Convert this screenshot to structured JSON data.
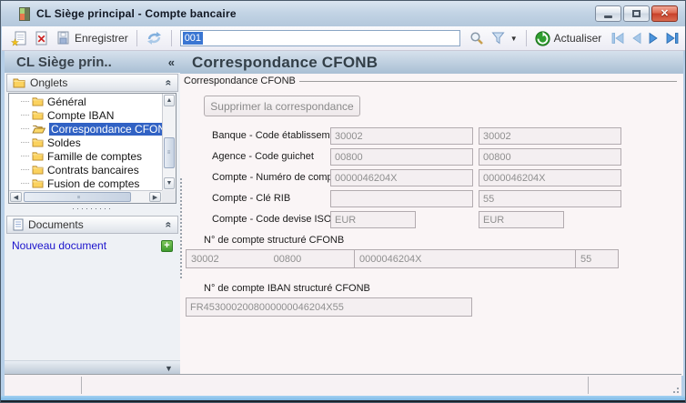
{
  "colors": {
    "selection_blue": "#3162c4",
    "link_blue": "#1a12cc",
    "close_red": "#c8402a",
    "plus_green": "#3f9b2f",
    "titlebar_blue": "#b4c8dc"
  },
  "window": {
    "title": "CL Siège principal -  Compte bancaire"
  },
  "toolbar": {
    "save_label": "Enregistrer",
    "record_value": "001",
    "refresh_label": "Actualiser"
  },
  "sidebar": {
    "header": "CL Siège prin..",
    "collapse_glyph": "«",
    "onglets": {
      "label": "Onglets",
      "items": [
        {
          "label": "Général"
        },
        {
          "label": "Compte IBAN"
        },
        {
          "label": "Correspondance CFONB",
          "selected": true
        },
        {
          "label": "Soldes"
        },
        {
          "label": "Famille de comptes"
        },
        {
          "label": "Contrats bancaires"
        },
        {
          "label": "Fusion de comptes"
        }
      ]
    },
    "documents": {
      "label": "Documents",
      "new_document_link": "Nouveau document"
    }
  },
  "main": {
    "header": "Correspondance CFONB",
    "groupbox_label": "Correspondance CFONB",
    "delete_button": "Supprimer la correspondance",
    "rows": [
      {
        "label": "Banque - Code établissement",
        "v1": "30002",
        "v2": "30002"
      },
      {
        "label": "Agence - Code guichet",
        "v1": "00800",
        "v2": "00800"
      },
      {
        "label": "Compte - Numéro de compte",
        "v1": "0000046204X",
        "v2": "0000046204X"
      },
      {
        "label": "Compte - Clé RIB",
        "v1": "",
        "v2": "55"
      },
      {
        "label": "Compte - Code devise ISO :",
        "v1": "EUR",
        "v2": "EUR"
      }
    ],
    "structured_cfonb": {
      "label": "N° de compte structuré CFONB",
      "bank": "30002",
      "branch": "00800",
      "account": "0000046204X",
      "key": "55"
    },
    "iban": {
      "label": "N° de compte IBAN structuré CFONB",
      "value": "FR4530002008000000046204X55"
    }
  }
}
